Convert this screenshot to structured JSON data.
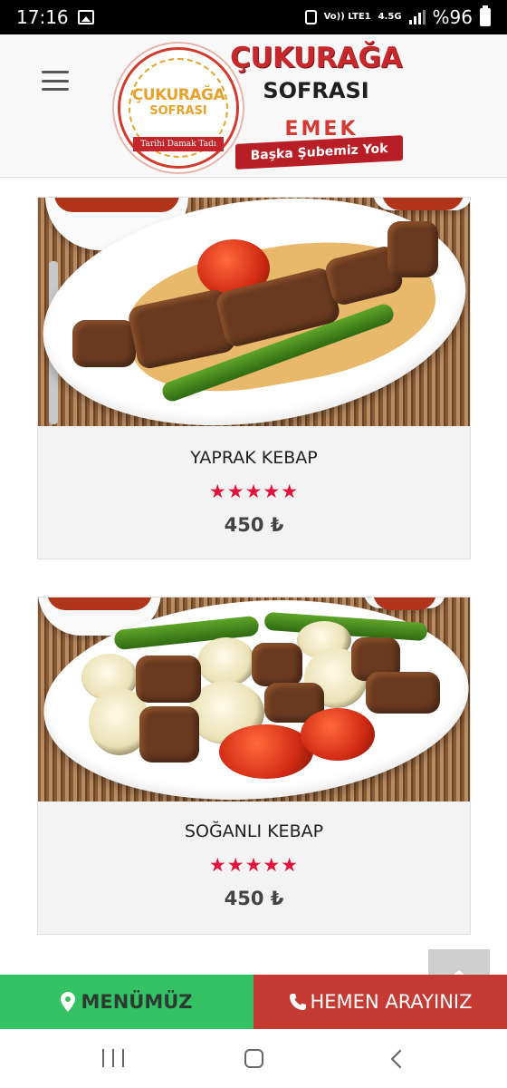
{
  "status_bar": {
    "time": "17:16",
    "network": "Vo)) LTE1",
    "network_type": "4.5G",
    "battery": "%96"
  },
  "header": {
    "logo": {
      "title": "ÇUKURAĞA",
      "subtitle": "SOFRASI",
      "badge_line1": "ÇUKURAĞA",
      "badge_line2": "SOFRASI",
      "badge_ribbon": "Tarihi Damak Tadı",
      "branch": "EMEK",
      "tagline": "Başka Şubemiz Yok"
    }
  },
  "products": [
    {
      "name": "YAPRAK KEBAP",
      "rating": 5,
      "stars": "★★★★★",
      "price": "450 ₺"
    },
    {
      "name": "SOĞANLI KEBAP",
      "rating": 5,
      "stars": "★★★★★",
      "price": "450 ₺"
    }
  ],
  "action_bar": {
    "menu_label": "MENÜMÜZ",
    "call_label": "HEMEN ARAYINIZ",
    "menu_color": "#34c265",
    "call_color": "#c63a34"
  },
  "colors": {
    "brand_red": "#c8282c",
    "star": "#e0143c"
  },
  "icons": {
    "menu_button": "map-pin-icon",
    "call_button": "phone-icon",
    "back_to_top": "chevron-up-icon"
  }
}
